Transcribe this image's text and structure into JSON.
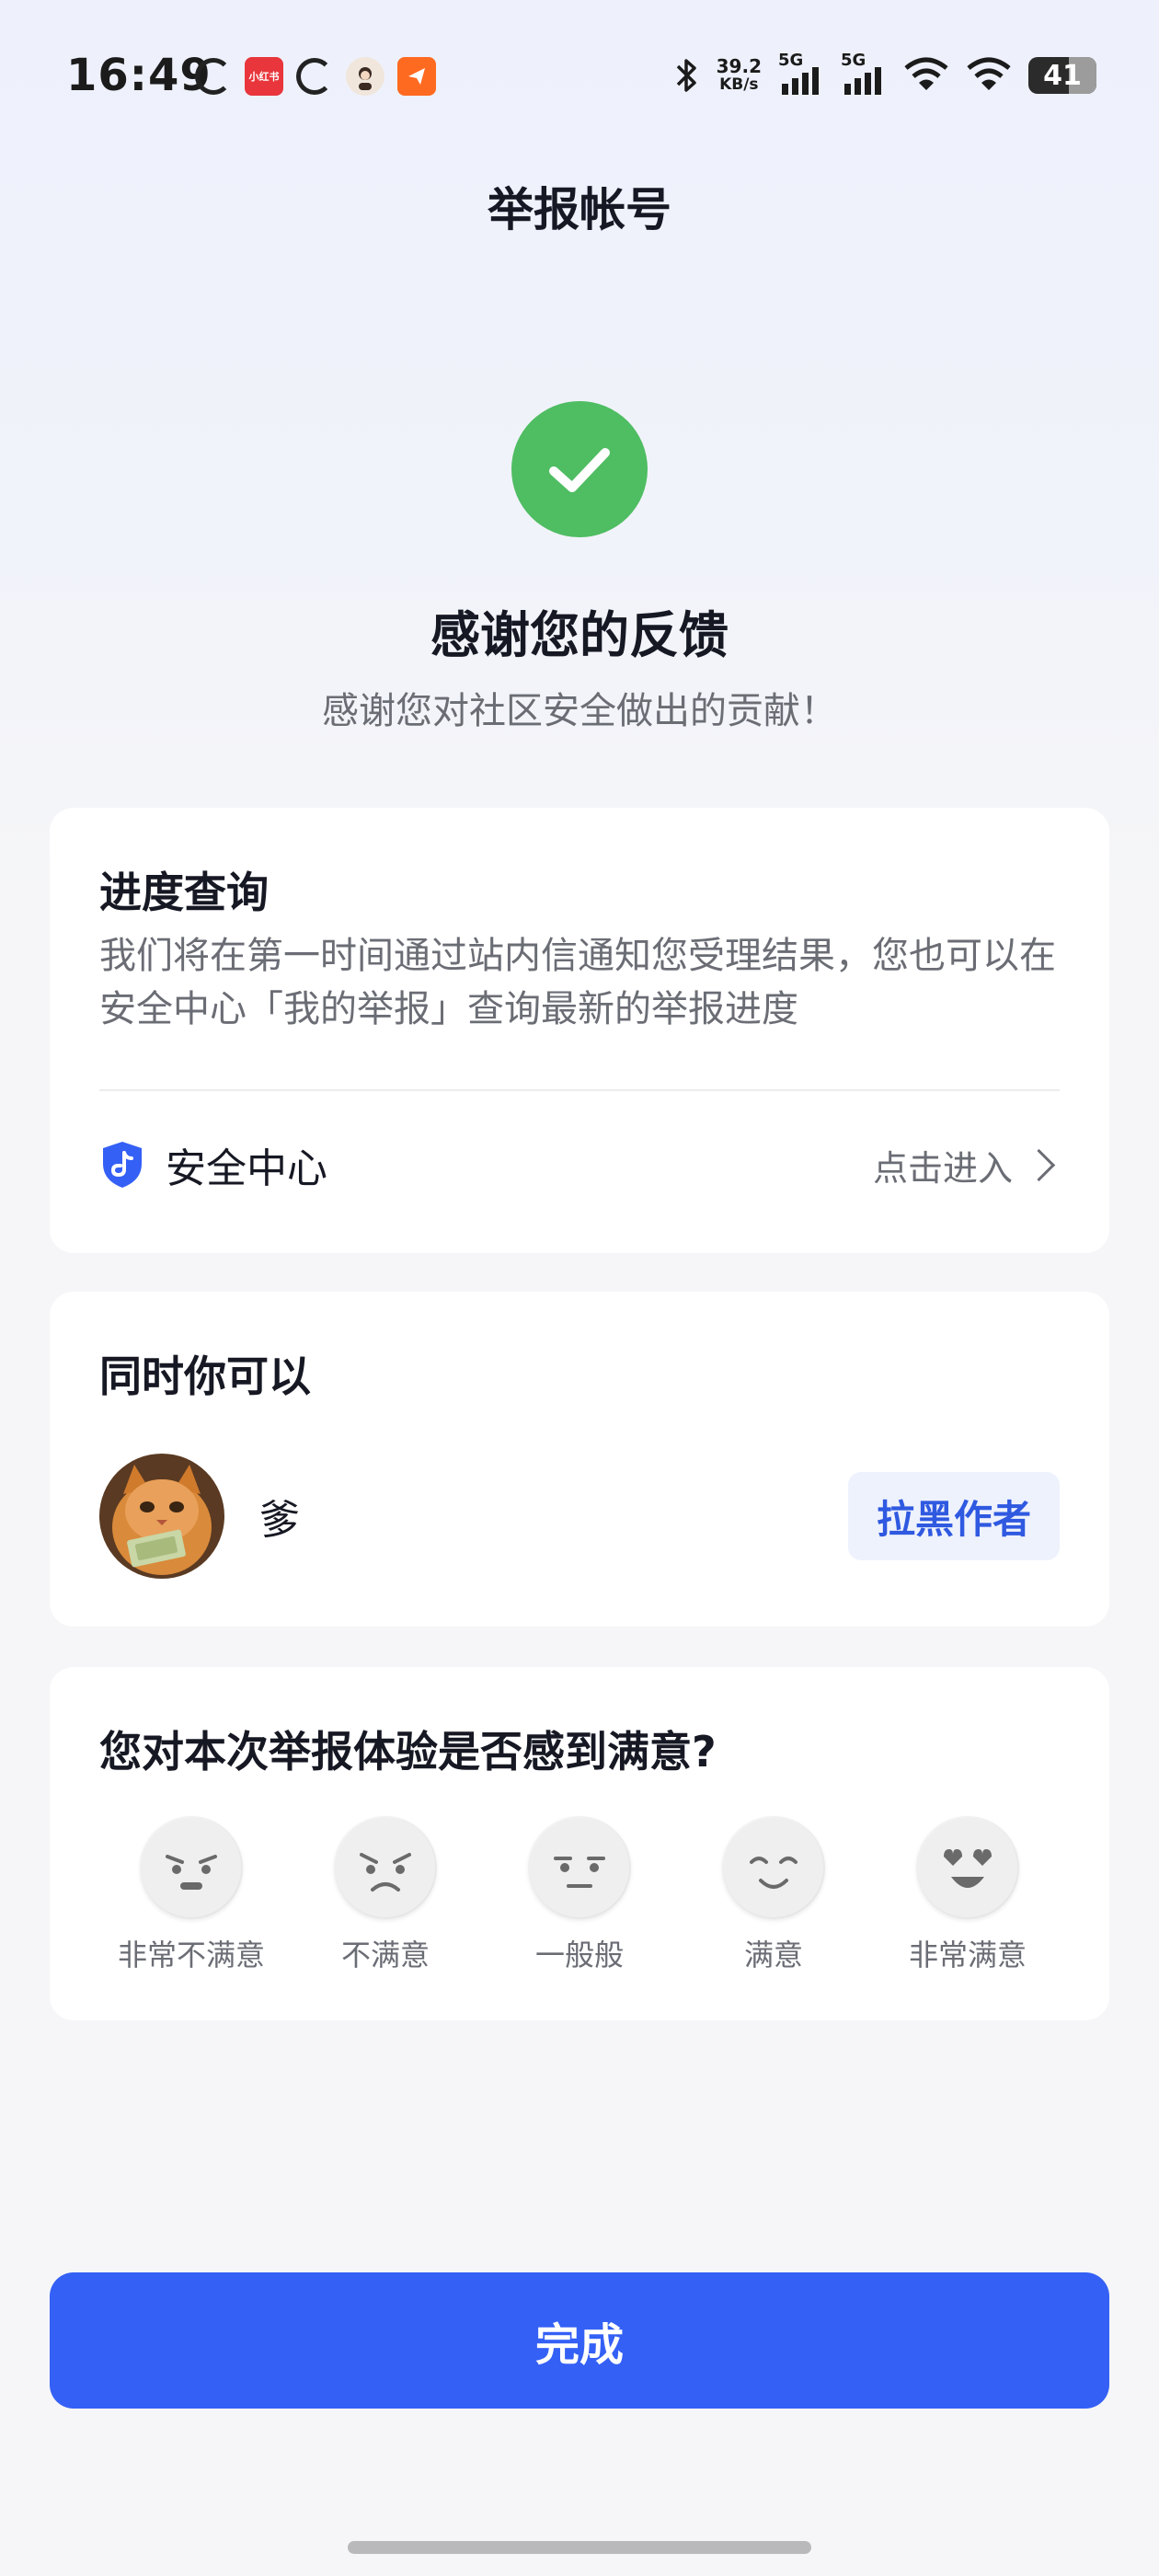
{
  "status_bar": {
    "time": "16:49",
    "net_speed_value": "39.2",
    "net_speed_unit": "KB/s",
    "sim1_label": "5G",
    "sim2_label": "5G",
    "battery": "41",
    "app_badge_label": "小红书",
    "icons": [
      "weibo-like-swirl-icon",
      "xiaohongshu-app-icon",
      "weibo-like-swirl-icon",
      "avatar-app-icon",
      "orange-send-app-icon",
      "bluetooth-icon",
      "signal-icon",
      "signal-icon",
      "wifi-icon",
      "wifi-icon",
      "battery-icon"
    ]
  },
  "header": {
    "title": "举报帐号"
  },
  "result": {
    "icon": "check-icon",
    "title": "感谢您的反馈",
    "subtitle": "感谢您对社区安全做出的贡献！"
  },
  "progress": {
    "title": "进度查询",
    "description": "我们将在第一时间通过站内信通知您受理结果，您也可以在安全中心「我的举报」查询最新的举报进度",
    "safety_center_label": "安全中心",
    "enter_label": "点击进入"
  },
  "also": {
    "title": "同时你可以",
    "user_name": "爹",
    "block_button": "拉黑作者"
  },
  "survey": {
    "title": "您对本次举报体验是否感到满意?",
    "options": [
      "非常不满意",
      "不满意",
      "一般般",
      "满意",
      "非常满意"
    ]
  },
  "footer": {
    "done_button": "完成"
  },
  "colors": {
    "primary": "#3460f5",
    "success": "#4fbd62",
    "link_bg": "#eef2fd"
  }
}
